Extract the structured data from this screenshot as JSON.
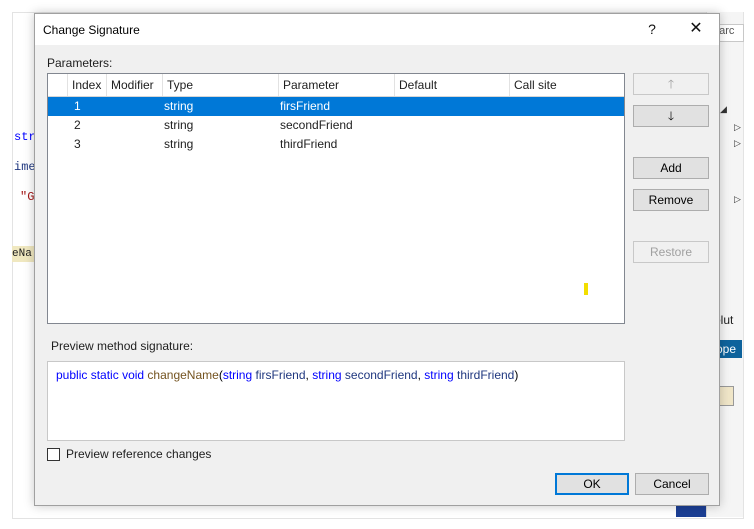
{
  "background": {
    "code_fragments": [
      "str",
      "ime",
      "\"G",
      "eNa"
    ],
    "search_text": "earc",
    "solution_text": "olut",
    "properties_text": "rope"
  },
  "dialog": {
    "title": "Change Signature",
    "help_label": "?",
    "close_label": "✕",
    "parameters_label": "Parameters:",
    "columns": [
      "Index",
      "Modifier",
      "Type",
      "Parameter",
      "Default",
      "Call site"
    ],
    "rows": [
      {
        "index": "1",
        "modifier": "",
        "type": "string",
        "parameter": "firsFriend",
        "default": "",
        "call_site": "",
        "selected": true
      },
      {
        "index": "2",
        "modifier": "",
        "type": "string",
        "parameter": "secondFriend",
        "default": "",
        "call_site": "",
        "selected": false
      },
      {
        "index": "3",
        "modifier": "",
        "type": "string",
        "parameter": "thirdFriend",
        "default": "",
        "call_site": "",
        "selected": false
      }
    ],
    "buttons": {
      "up_icon": "🡑",
      "down_icon": "🡓",
      "add": "Add",
      "remove": "Remove",
      "restore": "Restore",
      "ok": "OK",
      "cancel": "Cancel"
    },
    "preview_label": "Preview method signature:",
    "signature": {
      "public": "public",
      "static": "static",
      "void": "void",
      "method": "changeName",
      "open": "(",
      "t1": "string",
      "p1": "firsFriend",
      "comma1": ",",
      "t2": "string",
      "p2": "secondFriend",
      "comma2": ",",
      "t3": "string",
      "p3": "thirdFriend",
      "close": ")"
    },
    "preview_reference_label": "Preview reference changes",
    "preview_reference_checked": false
  },
  "colors": {
    "selection": "#0078d7",
    "keyword": "#0000ff",
    "method": "#74531f",
    "parameter": "#1f377f"
  }
}
